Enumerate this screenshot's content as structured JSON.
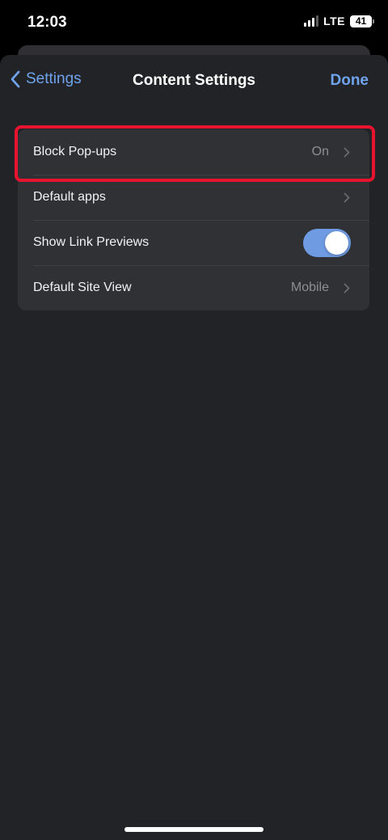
{
  "status_bar": {
    "time": "12:03",
    "network": "LTE",
    "battery": "41"
  },
  "navbar": {
    "back_label": "Settings",
    "title": "Content Settings",
    "done_label": "Done"
  },
  "settings": [
    {
      "label": "Block Pop-ups",
      "value": "On",
      "type": "disclosure"
    },
    {
      "label": "Default apps",
      "value": "",
      "type": "disclosure"
    },
    {
      "label": "Show Link Previews",
      "type": "toggle",
      "enabled": true
    },
    {
      "label": "Default Site View",
      "value": "Mobile",
      "type": "disclosure"
    }
  ],
  "colors": {
    "accent": "#6fa3ec",
    "toggle_on": "#6f9be3",
    "highlight": "#e8132f",
    "background": "#222327",
    "group": "#303135"
  }
}
